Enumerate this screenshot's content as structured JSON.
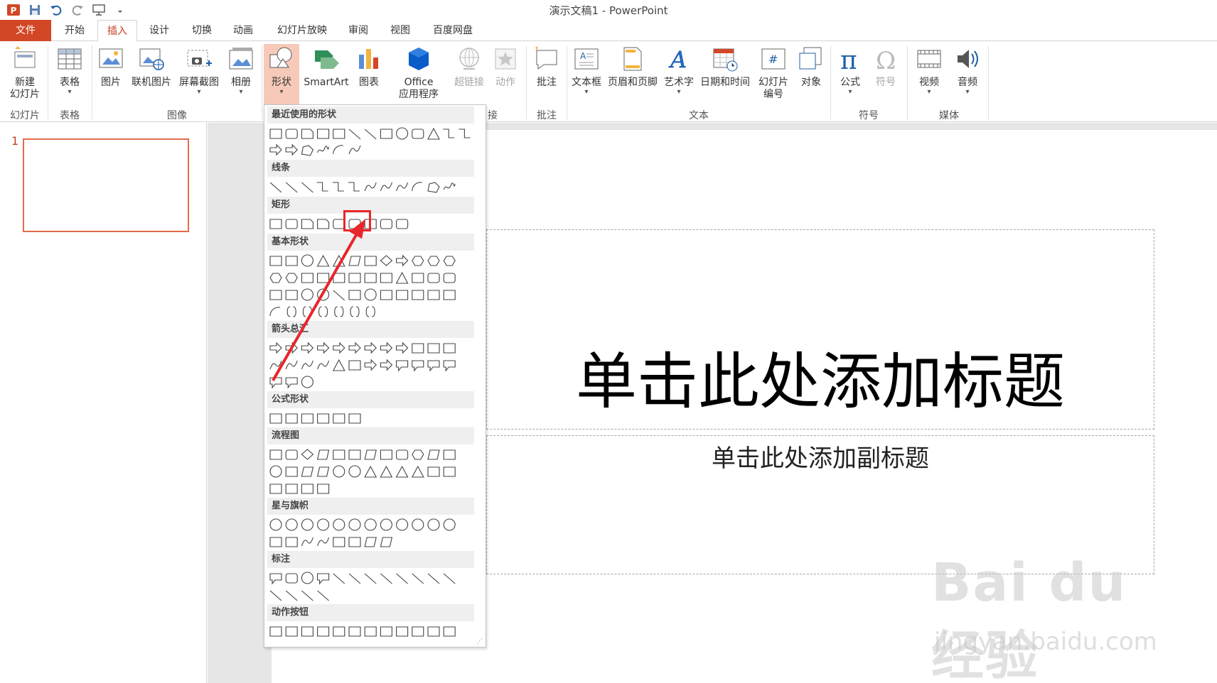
{
  "window": {
    "title": "演示文稿1 - PowerPoint"
  },
  "qat": [
    "powerpoint-logo-icon",
    "save-icon",
    "undo-icon",
    "redo-icon",
    "start-from-beginning-icon",
    "customize-icon"
  ],
  "tabs": {
    "file": "文件",
    "home": "开始",
    "insert": "插入",
    "design": "设计",
    "transitions": "切换",
    "animations": "动画",
    "slideshow": "幻灯片放映",
    "review": "审阅",
    "view": "视图",
    "baidu": "百度网盘"
  },
  "ribbon": {
    "new_slide_1": "新建",
    "new_slide_2": "幻灯片",
    "table": "表格",
    "picture": "图片",
    "online_picture": "联机图片",
    "screenshot": "屏幕截图",
    "album": "相册",
    "shapes": "形状",
    "smartart": "SmartArt",
    "chart": "图表",
    "office_1": "Office",
    "office_2": "应用程序",
    "hyperlink": "超链接",
    "action": "动作",
    "comment": "批注",
    "textbox": "文本框",
    "header_footer": "页眉和页脚",
    "wordart": "艺术字",
    "datetime": "日期和时间",
    "slide_number_1": "幻灯片",
    "slide_number_2": "编号",
    "object": "对象",
    "equation": "公式",
    "symbol": "符号",
    "video": "视频",
    "audio": "音频",
    "groups": {
      "slides": "幻灯片",
      "tables": "表格",
      "images": "图像",
      "links_tail": "接",
      "comments": "批注",
      "text": "文本",
      "symbols": "符号",
      "media": "媒体"
    }
  },
  "thumbnails": {
    "slide_number": "1"
  },
  "slide": {
    "title_placeholder": "单击此处添加标题",
    "subtitle_placeholder": "单击此处添加副标题"
  },
  "shapes_menu": {
    "sections": {
      "recent": "最近使用的形状",
      "lines": "线条",
      "rectangles": "矩形",
      "basic": "基本形状",
      "arrows": "箭头总汇",
      "equation": "公式形状",
      "flowchart": "流程图",
      "stars": "星与旗帜",
      "callouts": "标注",
      "action_buttons": "动作按钮"
    },
    "highlighted_shape": "single-corner-snipped-rectangle",
    "annotation_color": "#e8262b"
  },
  "watermark": {
    "logo": "Bai du 经验",
    "url": "jingyan.baidu.com"
  },
  "colors": {
    "accent": "#d24726",
    "active_tab": "#c43e1c",
    "selection": "#e46c4a",
    "pressed": "#f7c9b8"
  }
}
